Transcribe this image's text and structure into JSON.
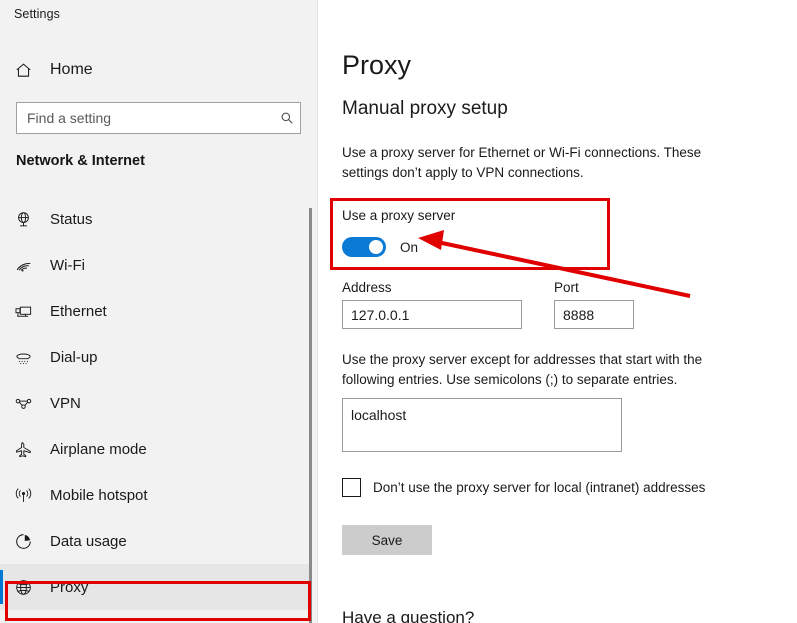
{
  "window": {
    "app_title": "Settings",
    "controls": {
      "minimize": "minimize-icon",
      "maximize": "maximize-icon",
      "close": "close-icon"
    }
  },
  "sidebar": {
    "home_label": "Home",
    "home_icon": "home-icon",
    "search": {
      "placeholder": "Find a setting",
      "value": "",
      "icon": "search-icon"
    },
    "heading": "Network & Internet",
    "items": [
      {
        "label": "Status",
        "icon": "globe-status-icon",
        "selected": false
      },
      {
        "label": "Wi-Fi",
        "icon": "wifi-icon",
        "selected": false
      },
      {
        "label": "Ethernet",
        "icon": "ethernet-icon",
        "selected": false
      },
      {
        "label": "Dial-up",
        "icon": "dialup-phone-icon",
        "selected": false
      },
      {
        "label": "VPN",
        "icon": "vpn-icon",
        "selected": false
      },
      {
        "label": "Airplane mode",
        "icon": "airplane-icon",
        "selected": false
      },
      {
        "label": "Mobile hotspot",
        "icon": "hotspot-icon",
        "selected": false
      },
      {
        "label": "Data usage",
        "icon": "pie-chart-icon",
        "selected": false
      },
      {
        "label": "Proxy",
        "icon": "globe-icon",
        "selected": true
      }
    ]
  },
  "main": {
    "page_title": "Proxy",
    "section_title": "Manual proxy setup",
    "section_description": "Use a proxy server for Ethernet or Wi-Fi connections. These settings don’t apply to VPN connections.",
    "use_proxy": {
      "label": "Use a proxy server",
      "state": "On",
      "enabled": true
    },
    "address": {
      "label": "Address",
      "value": "127.0.0.1"
    },
    "port": {
      "label": "Port",
      "value": "8888"
    },
    "exceptions": {
      "description": "Use the proxy server except for addresses that start with the following entries. Use semicolons (;) to separate entries.",
      "value": "localhost"
    },
    "bypass_local": {
      "label": "Don’t use the proxy server for local (intranet) addresses",
      "checked": false
    },
    "save_label": "Save",
    "footer_question": "Have a question?"
  },
  "annotations": {
    "toggle_box_color": "#e00000",
    "proxy_row_box_color": "#e00000",
    "arrow_color": "#e00000"
  },
  "colors": {
    "accent": "#0078d4",
    "toggle_on": "#0b7ad4",
    "sidebar_bg": "#f2f2f2",
    "save_button_bg": "#cccccc"
  }
}
